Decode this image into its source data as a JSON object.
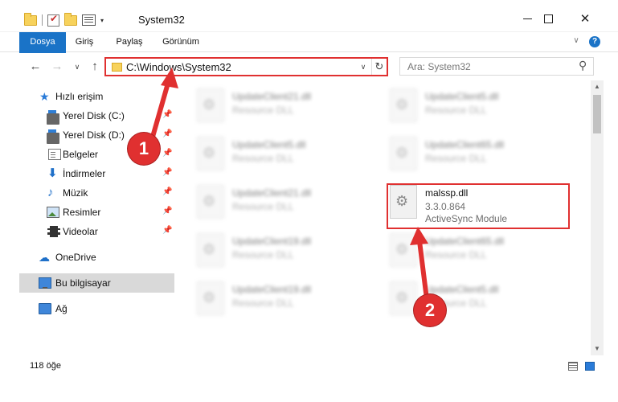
{
  "window": {
    "title": "System32",
    "minimize_glyph": "",
    "close_glyph": "✕"
  },
  "ribbon": {
    "tabs": [
      "Dosya",
      "Giriş",
      "Paylaş",
      "Görünüm"
    ],
    "chevron_glyph": "∨",
    "help_glyph": "?"
  },
  "nav": {
    "back_glyph": "←",
    "forward_glyph": "→",
    "recent_glyph": "∨",
    "up_glyph": "↑",
    "address": "C:\\Windows\\System32",
    "address_dropdown_glyph": "∨",
    "refresh_glyph": "↻",
    "search_placeholder": "Ara: System32",
    "search_icon": "⚲"
  },
  "sidebar": {
    "pin_glyph": "📌",
    "items": [
      {
        "label": "Hızlı erişim",
        "icon": "star-icon"
      },
      {
        "label": "Yerel Disk (C:)",
        "icon": "disk-icon",
        "pinned": true
      },
      {
        "label": "Yerel Disk (D:)",
        "icon": "disk-icon",
        "pinned": true
      },
      {
        "label": "Belgeler",
        "icon": "document-icon",
        "pinned": true
      },
      {
        "label": "İndirmeler",
        "icon": "download-icon",
        "pinned": true
      },
      {
        "label": "Müzik",
        "icon": "music-icon",
        "pinned": true
      },
      {
        "label": "Resimler",
        "icon": "pictures-icon",
        "pinned": true
      },
      {
        "label": "Videolar",
        "icon": "video-icon",
        "pinned": true
      },
      {
        "label": "OneDrive",
        "icon": "cloud-icon"
      },
      {
        "label": "Bu bilgisayar",
        "icon": "computer-icon",
        "selected": true
      },
      {
        "label": "Ağ",
        "icon": "network-icon"
      }
    ]
  },
  "files": [
    {
      "name": "UpdateClient21.dll",
      "meta": "Resource DLL",
      "blurred": true
    },
    {
      "name": "UpdateClient5.dll",
      "meta": "Resource DLL",
      "blurred": true
    },
    {
      "name": "UpdateClient5.dll",
      "meta": "Resource DLL",
      "blurred": true
    },
    {
      "name": "UpdateClient65.dll",
      "meta": "Resource DLL",
      "blurred": true
    },
    {
      "name": "UpdateClient21.dll",
      "meta": "Resource DLL",
      "blurred": true
    },
    {
      "name": "malssp.dll",
      "version": "3.3.0.864",
      "description": "ActiveSync Module",
      "blurred": false
    },
    {
      "name": "UpdateClient19.dll",
      "meta": "Resource DLL",
      "blurred": true
    },
    {
      "name": "UpdateClient65.dll",
      "meta": "Resource DLL",
      "blurred": true
    },
    {
      "name": "UpdateClient19.dll",
      "meta": "Resource DLL",
      "blurred": true
    },
    {
      "name": "UpdateClient5.dll",
      "meta": "Resource DLL",
      "blurred": true
    }
  ],
  "scrollbar": {
    "up_glyph": "▲",
    "down_glyph": "▼"
  },
  "status": {
    "item_count": "118 öğe"
  },
  "annotations": {
    "callout_1": "1",
    "callout_2": "2",
    "accent_color": "#e03030"
  }
}
